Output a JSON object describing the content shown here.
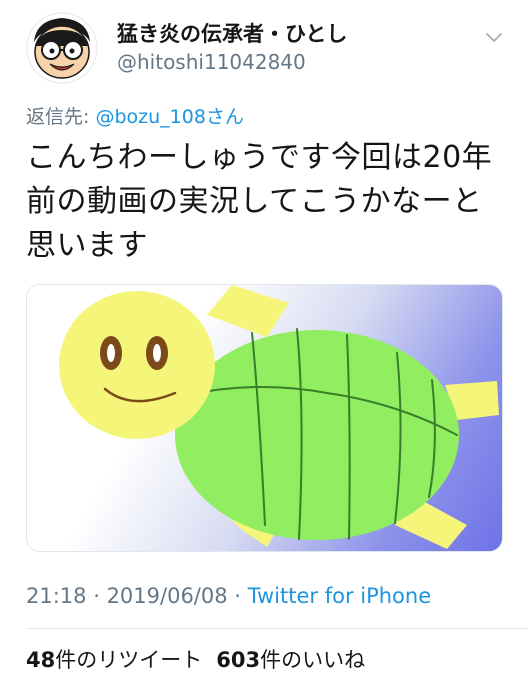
{
  "tweet": {
    "display_name": "猛き炎の伝承者・ひとし",
    "handle": "@hitoshi11042840",
    "reply_prefix": "返信先: ",
    "reply_mention": "@bozu_108さん",
    "text": "こんちわーしゅうです今回は20年前の動画の実況してこうかなーと思います",
    "time": "21:18",
    "sep1": " · ",
    "date": "2019/06/08",
    "sep2": " · ",
    "source": "Twitter for iPhone",
    "retweet_count": "48",
    "retweet_label": "件のリツイート",
    "like_count": "603",
    "like_label": "件のいいね"
  },
  "icons": {
    "avatar": "cartoon-boy-avatar",
    "menu": "chevron-down-icon"
  },
  "colors": {
    "link": "#1b95e0",
    "secondary_text": "#657786",
    "turtle_shell": "#90ee60",
    "turtle_body": "#f5f57a"
  }
}
